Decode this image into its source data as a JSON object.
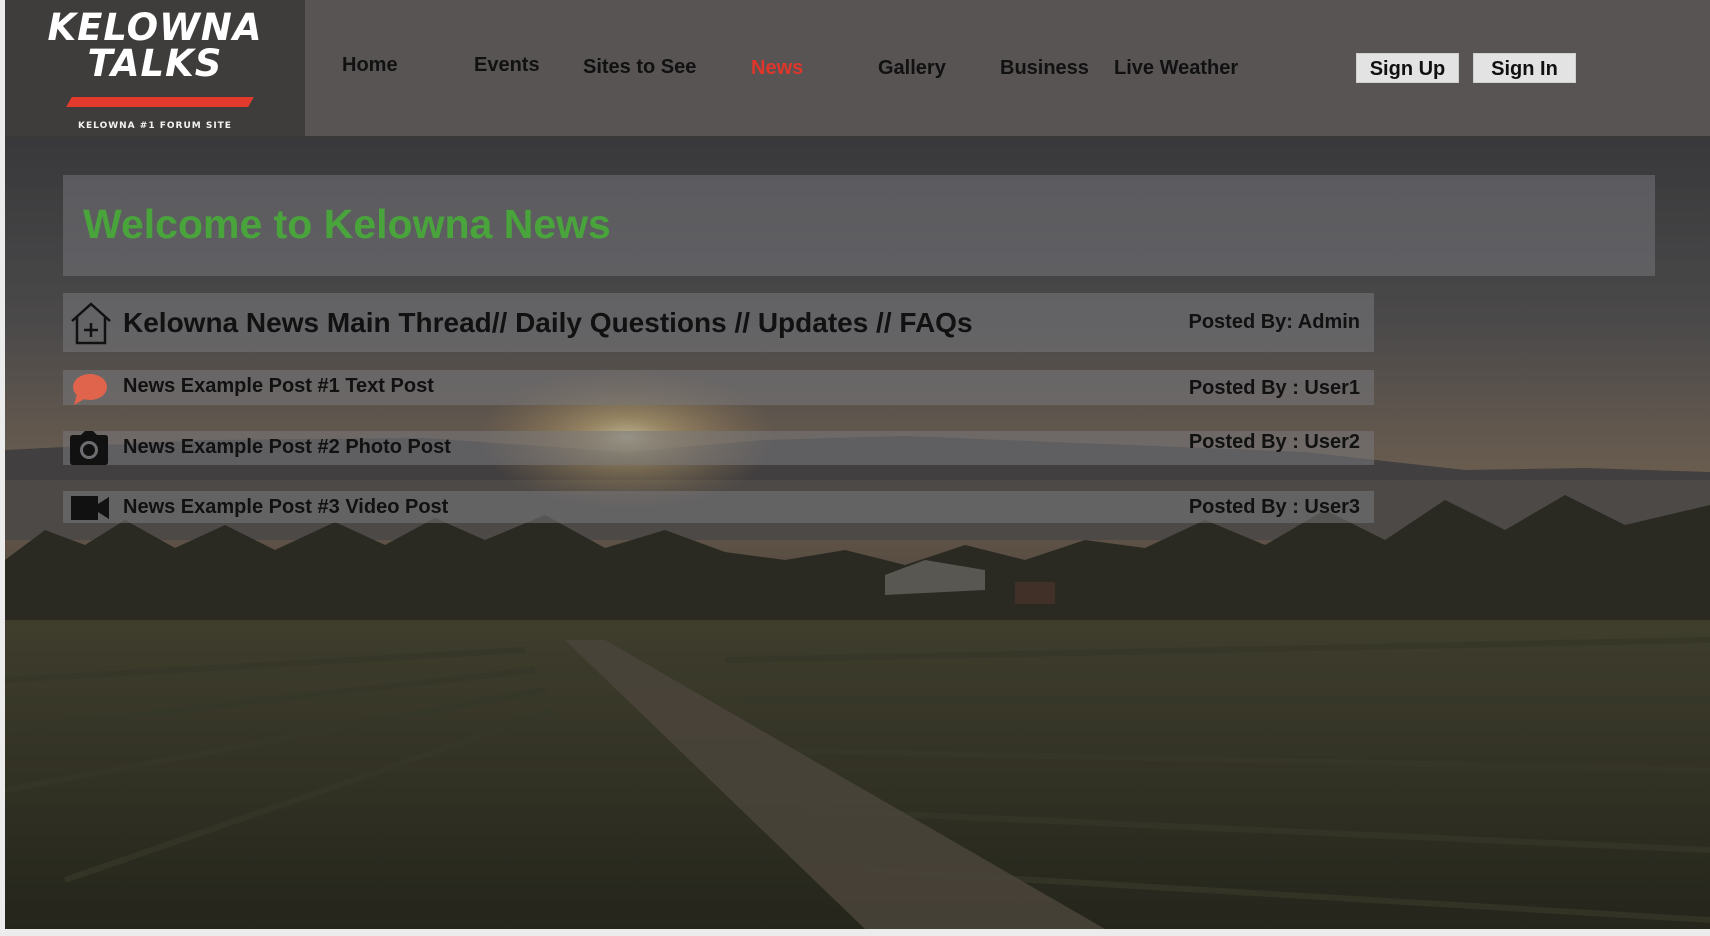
{
  "brand": {
    "line1": "KELOWNA",
    "line2": "TALKS",
    "tagline": "KELOWNA #1 FORUM SITE",
    "accent": "#e23b2e"
  },
  "nav": {
    "items": [
      {
        "label": "Home"
      },
      {
        "label": "Events"
      },
      {
        "label": "Sites to See"
      },
      {
        "label": "News",
        "active": true
      },
      {
        "label": "Gallery"
      },
      {
        "label": "Business"
      },
      {
        "label": "Live Weather"
      }
    ],
    "active_color": "#e0352a",
    "sign_up": "Sign Up",
    "sign_in": "Sign In"
  },
  "main": {
    "welcome_title": "Welcome to Kelowna News",
    "welcome_color": "#49a43c",
    "threads": [
      {
        "title": "Kelowna News Main Thread// Daily Questions // Updates // FAQs",
        "posted_by": "Posted By: Admin",
        "icon": "home-plus-icon"
      },
      {
        "title": "News Example Post #1 Text Post",
        "posted_by": "Posted By : User1",
        "icon": "speech-bubble-icon"
      },
      {
        "title": "News Example Post #2 Photo Post",
        "posted_by": "Posted By : User2",
        "icon": "camera-icon"
      },
      {
        "title": "News Example Post #3 Video Post",
        "posted_by": "Posted By : User3",
        "icon": "video-camera-icon"
      }
    ]
  }
}
